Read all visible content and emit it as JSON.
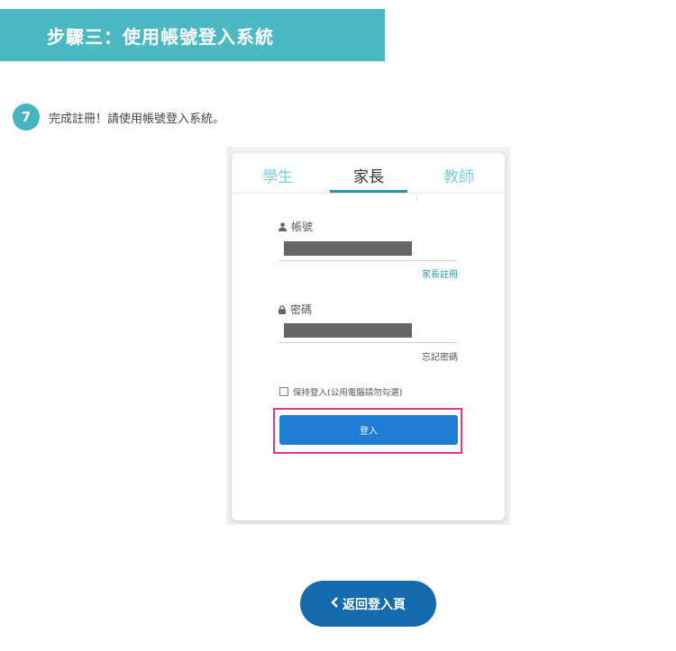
{
  "banner": {
    "title": "步驟三：使用帳號登入系統"
  },
  "step": {
    "number": "7",
    "text": "完成註冊！請使用帳號登入系統。"
  },
  "login": {
    "tabs": [
      "學生",
      "家長",
      "教師"
    ],
    "account_label": "帳號",
    "register_link": "家長註冊",
    "password_label": "密碼",
    "forgot_link": "忘記密碼",
    "remember_label": "保持登入(公用電腦請勿勾選)",
    "login_button": "登入"
  },
  "back_button": {
    "label": "返回登入頁"
  },
  "colors": {
    "banner": "#4bb8c2",
    "tab_accent": "#2a98a8",
    "login_button": "#1f7dd3",
    "highlight": "#e0368c",
    "back_button": "#1569ad"
  },
  "icons": {
    "account": "user-icon",
    "password": "lock-icon",
    "back": "chevron-left-icon"
  }
}
